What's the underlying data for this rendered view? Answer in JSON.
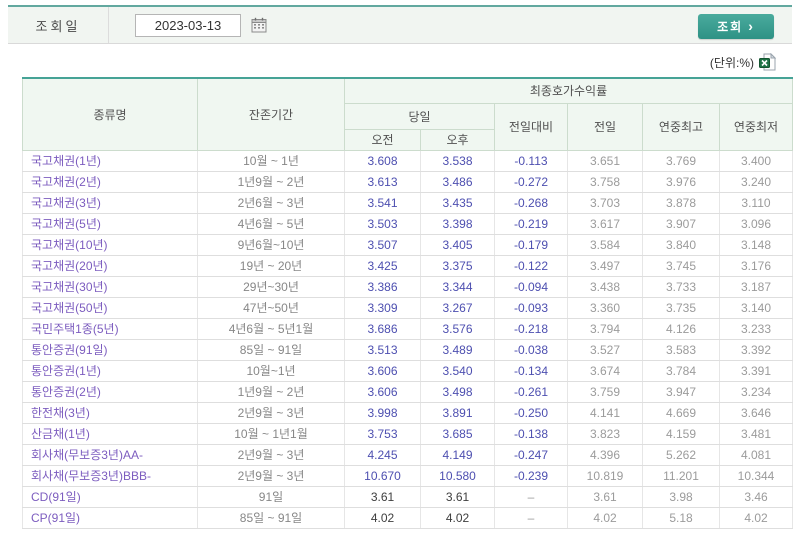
{
  "colors": {
    "accent_teal": "#3fa092",
    "header_bg": "#f0f7f1",
    "name_purple": "#7c5cbf",
    "value_blue": "#4d4fb0",
    "value_gray": "#9b9b9b"
  },
  "search_bar": {
    "label": "조회일",
    "date_value": "2023-03-13",
    "search_button": "조회",
    "search_arrow": "›"
  },
  "meta": {
    "unit_label": "(단위:%)"
  },
  "table": {
    "headers": {
      "col_type": "종류명",
      "col_maturity": "잔존기간",
      "group_yield": "최종호가수익률",
      "group_today": "당일",
      "col_am": "오전",
      "col_pm": "오후",
      "col_change": "전일대비",
      "col_prev": "전일",
      "col_high": "연중최고",
      "col_low": "연중최저"
    },
    "rows": [
      {
        "name": "국고채권(1년)",
        "maturity": "10월 ~ 1년",
        "am": "3.608",
        "pm": "3.538",
        "change": "-0.113",
        "prev": "3.651",
        "high": "3.769",
        "low": "3.400"
      },
      {
        "name": "국고채권(2년)",
        "maturity": "1년9월 ~ 2년",
        "am": "3.613",
        "pm": "3.486",
        "change": "-0.272",
        "prev": "3.758",
        "high": "3.976",
        "low": "3.240"
      },
      {
        "name": "국고채권(3년)",
        "maturity": "2년6월 ~ 3년",
        "am": "3.541",
        "pm": "3.435",
        "change": "-0.268",
        "prev": "3.703",
        "high": "3.878",
        "low": "3.110"
      },
      {
        "name": "국고채권(5년)",
        "maturity": "4년6월 ~ 5년",
        "am": "3.503",
        "pm": "3.398",
        "change": "-0.219",
        "prev": "3.617",
        "high": "3.907",
        "low": "3.096"
      },
      {
        "name": "국고채권(10년)",
        "maturity": "9년6월~10년",
        "am": "3.507",
        "pm": "3.405",
        "change": "-0.179",
        "prev": "3.584",
        "high": "3.840",
        "low": "3.148"
      },
      {
        "name": "국고채권(20년)",
        "maturity": "19년 ~ 20년",
        "am": "3.425",
        "pm": "3.375",
        "change": "-0.122",
        "prev": "3.497",
        "high": "3.745",
        "low": "3.176"
      },
      {
        "name": "국고채권(30년)",
        "maturity": "29년~30년",
        "am": "3.386",
        "pm": "3.344",
        "change": "-0.094",
        "prev": "3.438",
        "high": "3.733",
        "low": "3.187"
      },
      {
        "name": "국고채권(50년)",
        "maturity": "47년~50년",
        "am": "3.309",
        "pm": "3.267",
        "change": "-0.093",
        "prev": "3.360",
        "high": "3.735",
        "low": "3.140"
      },
      {
        "name": "국민주택1종(5년)",
        "maturity": "4년6월 ~ 5년1월",
        "am": "3.686",
        "pm": "3.576",
        "change": "-0.218",
        "prev": "3.794",
        "high": "4.126",
        "low": "3.233"
      },
      {
        "name": "통안증권(91일)",
        "maturity": "85일 ~ 91일",
        "am": "3.513",
        "pm": "3.489",
        "change": "-0.038",
        "prev": "3.527",
        "high": "3.583",
        "low": "3.392"
      },
      {
        "name": "통안증권(1년)",
        "maturity": "10월~1년",
        "am": "3.606",
        "pm": "3.540",
        "change": "-0.134",
        "prev": "3.674",
        "high": "3.784",
        "low": "3.391"
      },
      {
        "name": "통안증권(2년)",
        "maturity": "1년9월 ~ 2년",
        "am": "3.606",
        "pm": "3.498",
        "change": "-0.261",
        "prev": "3.759",
        "high": "3.947",
        "low": "3.234"
      },
      {
        "name": "한전채(3년)",
        "maturity": "2년9월 ~ 3년",
        "am": "3.998",
        "pm": "3.891",
        "change": "-0.250",
        "prev": "4.141",
        "high": "4.669",
        "low": "3.646"
      },
      {
        "name": "산금채(1년)",
        "maturity": "10월 ~ 1년1월",
        "am": "3.753",
        "pm": "3.685",
        "change": "-0.138",
        "prev": "3.823",
        "high": "4.159",
        "low": "3.481"
      },
      {
        "name": "회사채(무보증3년)AA-",
        "maturity": "2년9월 ~ 3년",
        "am": "4.245",
        "pm": "4.149",
        "change": "-0.247",
        "prev": "4.396",
        "high": "5.262",
        "low": "4.081"
      },
      {
        "name": "회사채(무보증3년)BBB-",
        "maturity": "2년9월 ~ 3년",
        "am": "10.670",
        "pm": "10.580",
        "change": "-0.239",
        "prev": "10.819",
        "high": "11.201",
        "low": "10.344"
      },
      {
        "name": "CD(91일)",
        "maturity": "91일",
        "am": "3.61",
        "pm": "3.61",
        "change": "–",
        "prev": "3.61",
        "high": "3.98",
        "low": "3.46",
        "no_change": true
      },
      {
        "name": "CP(91일)",
        "maturity": "85일 ~ 91일",
        "am": "4.02",
        "pm": "4.02",
        "change": "–",
        "prev": "4.02",
        "high": "5.18",
        "low": "4.02",
        "no_change": true
      }
    ]
  }
}
